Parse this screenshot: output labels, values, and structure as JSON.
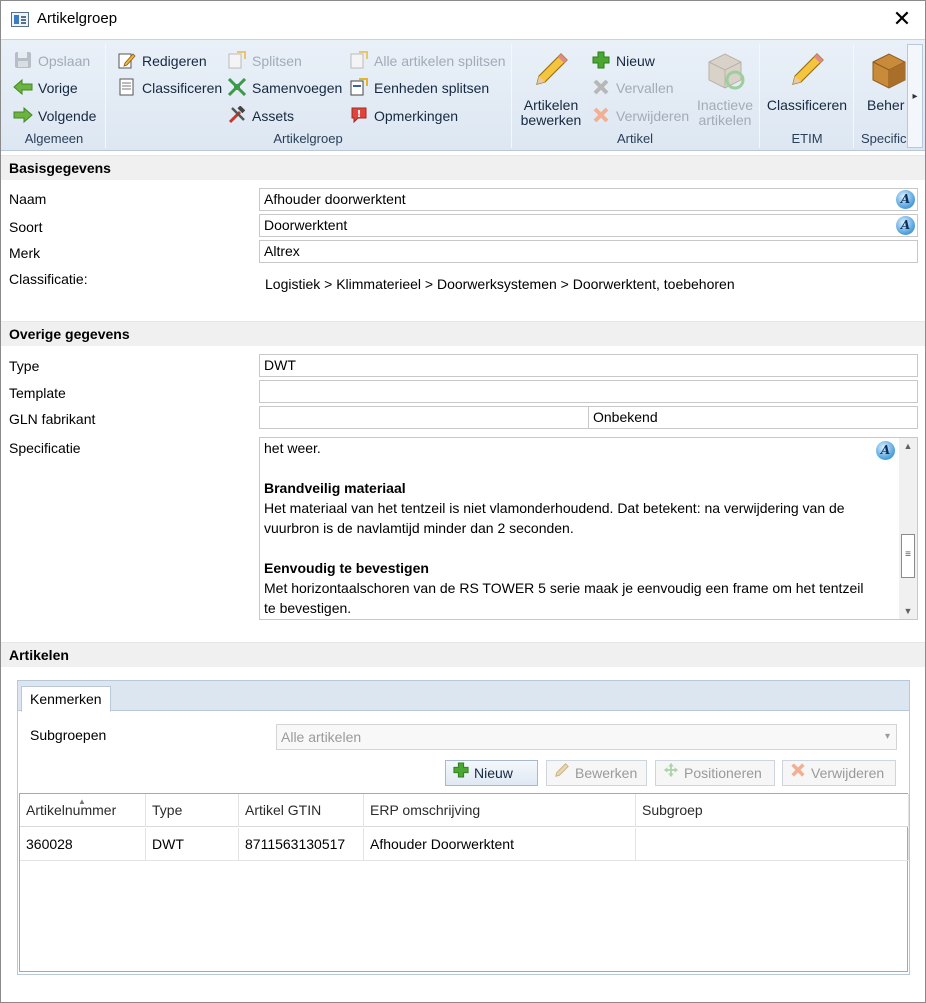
{
  "window": {
    "title": "Artikelgroep",
    "close_glyph": "✕"
  },
  "ribbon": {
    "algemeen": {
      "label": "Algemeen",
      "items": [
        {
          "label": "Opslaan",
          "icon": "save-icon",
          "enabled": false
        },
        {
          "label": "Vorige",
          "icon": "arrow-left-icon",
          "enabled": true
        },
        {
          "label": "Volgende",
          "icon": "arrow-right-icon",
          "enabled": true
        }
      ]
    },
    "artikelgroep": {
      "label": "Artikelgroep",
      "col1": [
        {
          "label": "Redigeren",
          "icon": "edit-icon",
          "enabled": true
        },
        {
          "label": "Classificeren",
          "icon": "classify-icon",
          "enabled": true
        }
      ],
      "col2": [
        {
          "label": "Splitsen",
          "icon": "split-icon",
          "enabled": false
        },
        {
          "label": "Samenvoegen",
          "icon": "merge-icon",
          "enabled": true
        },
        {
          "label": "Assets",
          "icon": "tools-icon",
          "enabled": true
        }
      ],
      "col3": [
        {
          "label": "Alle artikelen splitsen",
          "icon": "split-all-icon",
          "enabled": false
        },
        {
          "label": "Eenheden splitsen",
          "icon": "split-units-icon",
          "enabled": true
        },
        {
          "label": "Opmerkingen",
          "icon": "remarks-icon",
          "enabled": true
        }
      ]
    },
    "artikel": {
      "label": "Artikel",
      "big_edit": {
        "line1": "Artikelen",
        "line2": "bewerken",
        "icon": "pencil-icon"
      },
      "items": [
        {
          "label": "Nieuw",
          "icon": "plus-icon",
          "enabled": true
        },
        {
          "label": "Vervallen",
          "icon": "x-gray-icon",
          "enabled": false
        },
        {
          "label": "Verwijderen",
          "icon": "x-orange-icon",
          "enabled": false
        }
      ],
      "big_inactive": {
        "line1": "Inactieve",
        "line2": "artikelen",
        "icon": "box-refresh-icon"
      }
    },
    "etim": {
      "label": "ETIM",
      "big": {
        "line1": "Classificeren",
        "icon": "pencil-icon"
      }
    },
    "specific": {
      "label": "Specific",
      "big": {
        "line1": "Beher",
        "icon": "box-icon"
      }
    },
    "scroll_glyph": "▸"
  },
  "basis": {
    "title": "Basisgegevens",
    "naam": {
      "label": "Naam",
      "value": "Afhouder doorwerktent"
    },
    "soort": {
      "label": "Soort",
      "value": "Doorwerktent"
    },
    "merk": {
      "label": "Merk",
      "value": "Altrex"
    },
    "classificatie": {
      "label": "Classificatie:",
      "value": "Logistiek > Klimmaterieel > Doorwerksystemen > Doorwerktent, toebehoren"
    },
    "lang_glyph": "A"
  },
  "overige": {
    "title": "Overige gegevens",
    "type": {
      "label": "Type",
      "value": "DWT"
    },
    "template": {
      "label": "Template",
      "value": ""
    },
    "gln": {
      "label": "GLN fabrikant",
      "value": "",
      "status": "Onbekend"
    },
    "specificatie": {
      "label": "Specificatie",
      "lines": [
        {
          "kind": "text",
          "text": "het weer."
        },
        {
          "kind": "gap"
        },
        {
          "kind": "heading",
          "text": "Brandveilig materiaal"
        },
        {
          "kind": "text",
          "text": "Het materiaal van het tentzeil is niet vlamonderhoudend. Dat betekent: na verwijdering van de"
        },
        {
          "kind": "text",
          "text": "vuurbron is de navlamtijd minder dan 2 seconden."
        },
        {
          "kind": "gap"
        },
        {
          "kind": "heading",
          "text": "Eenvoudig te bevestigen"
        },
        {
          "kind": "text",
          "text": "Met horizontaalschoren van de RS TOWER 5 serie maak je eenvoudig een frame om het tentzeil"
        },
        {
          "kind": "text",
          "text": "te bevestigen."
        }
      ],
      "scroll_up": "▲",
      "scroll_down": "▼",
      "thumb_glyph": "≡"
    }
  },
  "artikelen": {
    "title": "Artikelen",
    "tab": "Kenmerken",
    "subgroepen": {
      "label": "Subgroepen",
      "value": "Alle artikelen",
      "caret": "▾"
    },
    "buttons": [
      {
        "label": "Nieuw",
        "icon": "plus-icon",
        "enabled": true
      },
      {
        "label": "Bewerken",
        "icon": "pencil-icon",
        "enabled": false
      },
      {
        "label": "Positioneren",
        "icon": "move-icon",
        "enabled": false
      },
      {
        "label": "Verwijderen",
        "icon": "x-orange-icon",
        "enabled": false
      }
    ],
    "columns": [
      "Artikelnummer",
      "Type",
      "Artikel GTIN",
      "ERP omschrijving",
      "Subgroep"
    ],
    "sort_glyph": "▲",
    "rows": [
      [
        "360028",
        "DWT",
        "8711563130517",
        "Afhouder Doorwerktent",
        ""
      ]
    ]
  },
  "colors": {
    "ribbon_bg": "#e3ebf5",
    "section_bg": "#f0f0f0",
    "plus_green": "#4aa832",
    "arrow_green": "#6cb33f",
    "remove_orange": "#e8824a"
  }
}
